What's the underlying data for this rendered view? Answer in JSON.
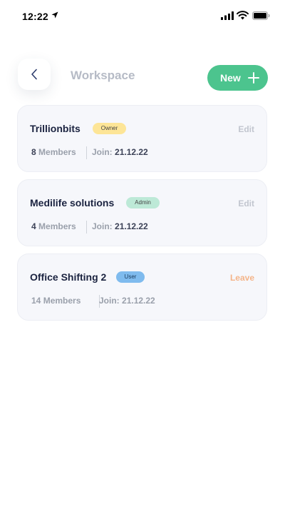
{
  "status_bar": {
    "time": "12:22"
  },
  "header": {
    "title": "Workspace",
    "new_label": "New"
  },
  "workspaces": [
    {
      "name": "Trillionbits",
      "role": "Owner",
      "action": "Edit",
      "members_count": "8",
      "members_label": "Members",
      "join_label": "Join:",
      "join_date": "21.12.22"
    },
    {
      "name": "Medilife solutions",
      "role": "Admin",
      "action": "Edit",
      "members_count": "4",
      "members_label": "Members",
      "join_label": "Join:",
      "join_date": "21.12.22"
    },
    {
      "name": "Office Shifting 2",
      "role": "User",
      "action": "Leave",
      "members_count": "14",
      "members_label": "Members",
      "join_label": "Join:",
      "join_date": "21.12.22"
    }
  ],
  "colors": {
    "accent": "#4cc48e",
    "owner_badge": "#fde597",
    "admin_badge": "#bde9d7",
    "user_badge": "#7fbbee",
    "leave": "#f4b489"
  },
  "icons": [
    "location-arrow-icon",
    "signal-icon",
    "wifi-icon",
    "battery-icon",
    "chevron-left-icon",
    "plus-icon"
  ]
}
